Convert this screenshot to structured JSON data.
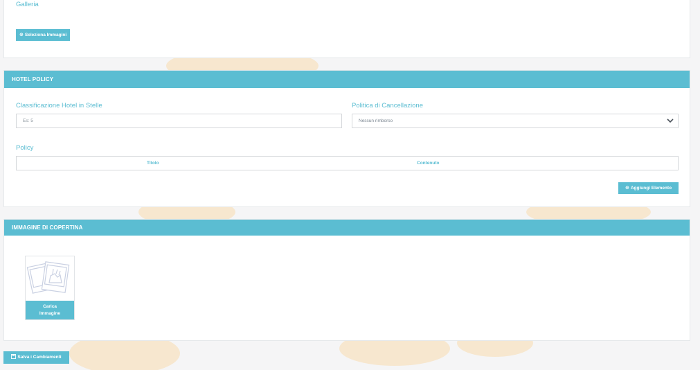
{
  "gallery": {
    "label": "Galleria",
    "select_button": "Seleziona Immagini"
  },
  "hotel_policy": {
    "header": "HOTEL POLICY",
    "stars_label": "Classificazione Hotel in Stelle",
    "stars_placeholder": "Es: 5",
    "cancellation_label": "Politica di Cancellazione",
    "cancellation_value": "Nessun rimborso",
    "policy_label": "Policy",
    "table_columns": [
      "Titolo",
      "Contenuto"
    ],
    "add_button": "Aggiungi Elemento"
  },
  "cover_image": {
    "header": "IMMAGINE DI COPERTINA",
    "upload_label": "Carica Immagine"
  },
  "footer": {
    "save_button": "Salva i Cambiamenti"
  },
  "colors": {
    "accent": "#5bbdd2",
    "background": "#f5f5f6",
    "decor": "#f7e7cf"
  },
  "icons": {
    "select": "plus-circle-icon",
    "add": "plus-circle-icon",
    "dropdown": "chevron-down-icon",
    "placeholder": "image-placeholder-icon",
    "save": "save-icon"
  }
}
